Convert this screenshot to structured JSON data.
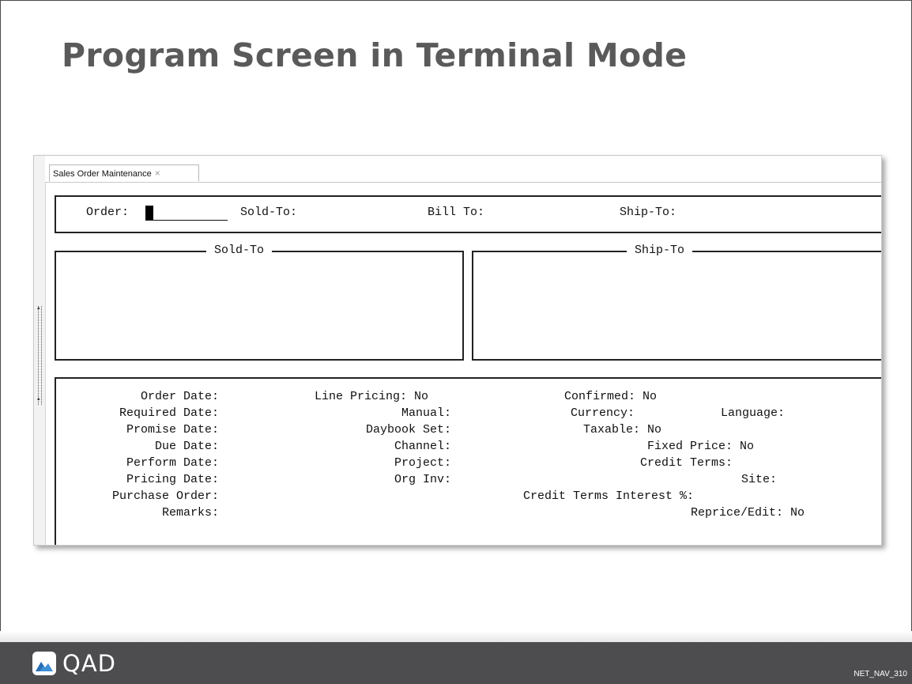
{
  "slide": {
    "title": "Program Screen in Terminal Mode",
    "code": "NET_NAV_310",
    "logo_text": "QAD"
  },
  "window": {
    "tab_label": "Sales Order Maintenance",
    "tab_close": "×"
  },
  "header": {
    "order_label": "Order:",
    "sold_to_label": "Sold-To:",
    "bill_to_label": "Bill To:",
    "ship_to_label": "Ship-To:"
  },
  "frames": {
    "sold_to_title": "Sold-To",
    "ship_to_title": "Ship-To"
  },
  "details": {
    "col1": [
      "Order Date:",
      "Required Date:",
      "Promise Date:",
      "Due Date:",
      "Perform Date:",
      "Pricing Date:",
      "Purchase Order:",
      "Remarks:"
    ],
    "col2": [
      "Line Pricing: No",
      "Manual:",
      "Daybook Set:",
      "Channel:",
      "Project:",
      "Org Inv:"
    ],
    "col3": [
      "Confirmed: No",
      "Currency:",
      "Taxable: No"
    ],
    "language": "Language:",
    "col4": [
      "Fixed Price: No",
      "Credit Terms:",
      "Site:"
    ],
    "credit_interest": "Credit Terms Interest %:",
    "reprice": "Reprice/Edit: No"
  },
  "colors": {
    "title": "#5a5a5a",
    "footer": "#4d4d4f",
    "logo_blue": "#3d8fd6"
  },
  "icons": {
    "logo": "qad-logo-icon",
    "tab_close": "close-icon"
  }
}
